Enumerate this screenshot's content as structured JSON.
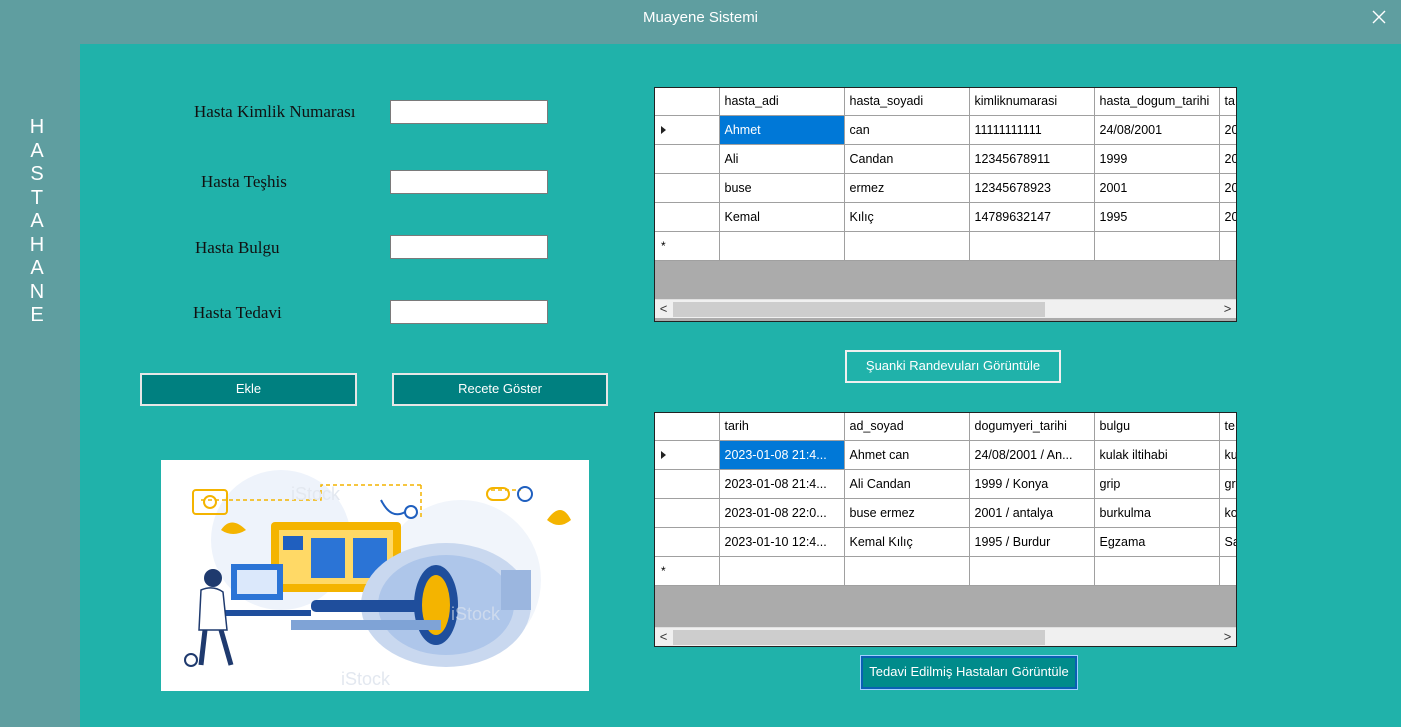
{
  "window": {
    "title": "Muayene Sistemi"
  },
  "sidebar": {
    "letters": [
      "H",
      "A",
      "S",
      "T",
      "A",
      "H",
      "A",
      "N",
      "E"
    ]
  },
  "form": {
    "kimlik_label": "Hasta Kimlik Numarası",
    "teshis_label": "Hasta Teşhis",
    "bulgu_label": "Hasta Bulgu",
    "tedavi_label": "Hasta Tedavi",
    "kimlik_value": "",
    "teshis_value": "",
    "bulgu_value": "",
    "tedavi_value": "",
    "ekle_label": "Ekle",
    "recete_label": "Recete Göster"
  },
  "buttons": {
    "randevular": "Şuanki Randevuları Görüntüle",
    "tedavi_edilmis": "Tedavi Edilmiş Hastaları Görüntüle"
  },
  "grid_top": {
    "columns": [
      "hasta_adi",
      "hasta_soyadi",
      "kimliknumarasi",
      "hasta_dogum_tarihi",
      "ta"
    ],
    "rows": [
      [
        "Ahmet",
        "can",
        "11111111111",
        "24/08/2001",
        "20"
      ],
      [
        "Ali",
        "Candan",
        "12345678911",
        "1999",
        "20"
      ],
      [
        "buse",
        "ermez",
        "12345678923",
        "2001",
        "20"
      ],
      [
        "Kemal",
        "Kılıç",
        "14789632147",
        "1995",
        "20"
      ]
    ],
    "new_row_marker": "*"
  },
  "grid_bottom": {
    "columns": [
      "tarih",
      "ad_soyad",
      "dogumyeri_tarihi",
      "bulgu",
      "te"
    ],
    "rows": [
      [
        "2023-01-08 21:4...",
        "Ahmet  can",
        "24/08/2001 / An...",
        "kulak iltihabi",
        "ku"
      ],
      [
        "2023-01-08 21:4...",
        "Ali  Candan",
        "1999 / Konya",
        "grip",
        "gri"
      ],
      [
        "2023-01-08 22:0...",
        "buse  ermez",
        "2001 / antalya",
        "burkulma",
        "ko"
      ],
      [
        "2023-01-10 12:4...",
        "Kemal  Kılıç",
        "1995 / Burdur",
        "Egzama",
        "Sa"
      ]
    ],
    "new_row_marker": "*"
  },
  "scroll": {
    "left_arrow": "<",
    "right_arrow": ">"
  },
  "image": {
    "watermark": "iStock"
  },
  "colors": {
    "frame": "#5f9ea0",
    "panel": "#20b2aa",
    "button": "#008080",
    "selection": "#0078d7"
  }
}
